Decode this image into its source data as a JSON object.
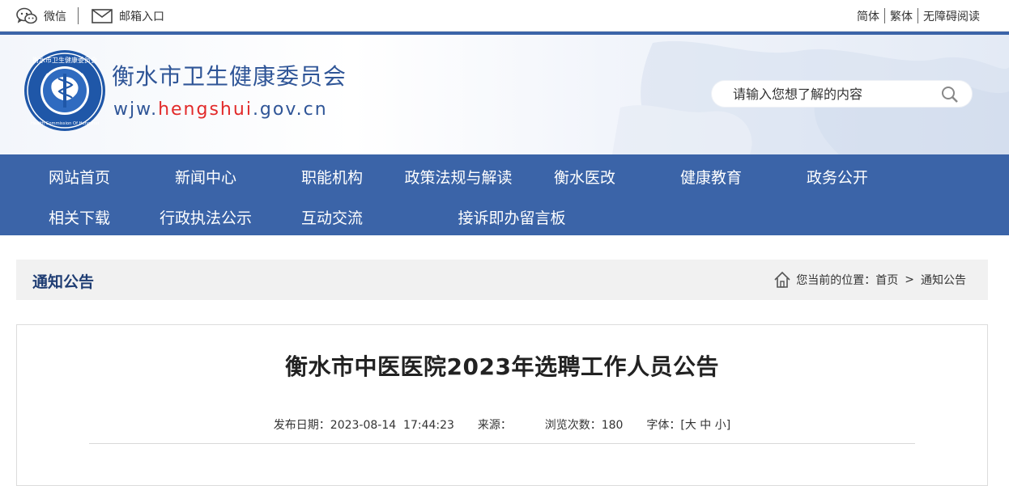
{
  "topbar": {
    "wechat_label": "微信",
    "mail_label": "邮箱入口",
    "simplified": "简体",
    "traditional": "繁体",
    "accessibility": "无障碍阅读"
  },
  "header": {
    "site_title": "衡水市卫生健康委员会",
    "url_prefix": "wjw.",
    "url_highlight": "hengshui",
    "url_suffix": ".gov.cn",
    "logo_text": "衡水市卫生健康委员会",
    "logo_text_en": "Health Commission Of Hengshui",
    "search_placeholder": "请输入您想了解的内容"
  },
  "nav": {
    "items": [
      "网站首页",
      "新闻中心",
      "职能机构",
      "政策法规与解读",
      "衡水医改",
      "健康教育",
      "政务公开",
      "相关下载",
      "行政执法公示",
      "互动交流",
      "接诉即办留言板"
    ]
  },
  "breadcrumb": {
    "section_title": "通知公告",
    "location_label": "您当前的位置：",
    "home": "首页",
    "separator": ">",
    "current": "通知公告"
  },
  "article": {
    "title": "衡水市中医医院2023年选聘工作人员公告",
    "publish_date_label": "发布日期：",
    "publish_date": "2023-08-14  17:44:23",
    "source_label": "来源：",
    "views_label": "浏览次数：",
    "views": "180",
    "font_label": "字体：",
    "font_open": "[",
    "font_large": "大",
    "font_medium": "中",
    "font_small": "小",
    "font_close": "]"
  },
  "colors": {
    "brand_blue": "#3b64a8",
    "title_blue": "#2f5597",
    "url_red": "#e22a2a"
  },
  "icons": [
    "wechat-icon",
    "mail-icon",
    "search-icon",
    "home-icon",
    "logo-emblem"
  ]
}
